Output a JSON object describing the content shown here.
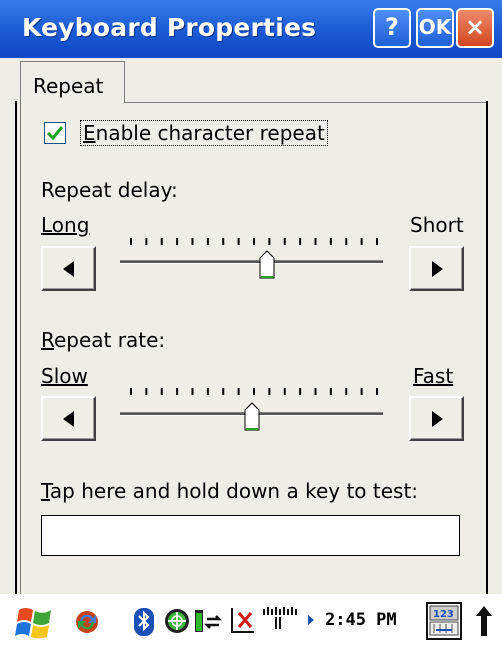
{
  "window": {
    "title": "Keyboard Properties",
    "help_label": "?",
    "ok_label": "OK",
    "close_label": "×"
  },
  "tabs": [
    {
      "label": "Repeat",
      "selected": true
    }
  ],
  "repeat": {
    "enable_checkbox": {
      "label": "Enable character repeat",
      "checked": true
    },
    "delay": {
      "label": "Repeat delay:",
      "min_label": "Long",
      "max_label": "Short",
      "tick_count": 17,
      "value_fraction": 0.56
    },
    "rate": {
      "label": "Repeat rate:",
      "min_label": "Slow",
      "max_label": "Fast",
      "tick_count": 17,
      "value_fraction": 0.5
    },
    "test_label": "Tap here and hold down a key to test:",
    "test_value": ""
  },
  "taskbar": {
    "clock": "2:45 PM",
    "icons": [
      "start-flag-icon",
      "sync-icon",
      "bluetooth-icon",
      "network-globe-icon",
      "battery-icon",
      "connectivity-icon",
      "signal-bars-icon",
      "keyboard-input-icon",
      "up-arrow-icon"
    ]
  },
  "colors": {
    "titlebar": "#1f5fd8",
    "dialog_bg": "#efeee6",
    "check": "#21a121"
  }
}
